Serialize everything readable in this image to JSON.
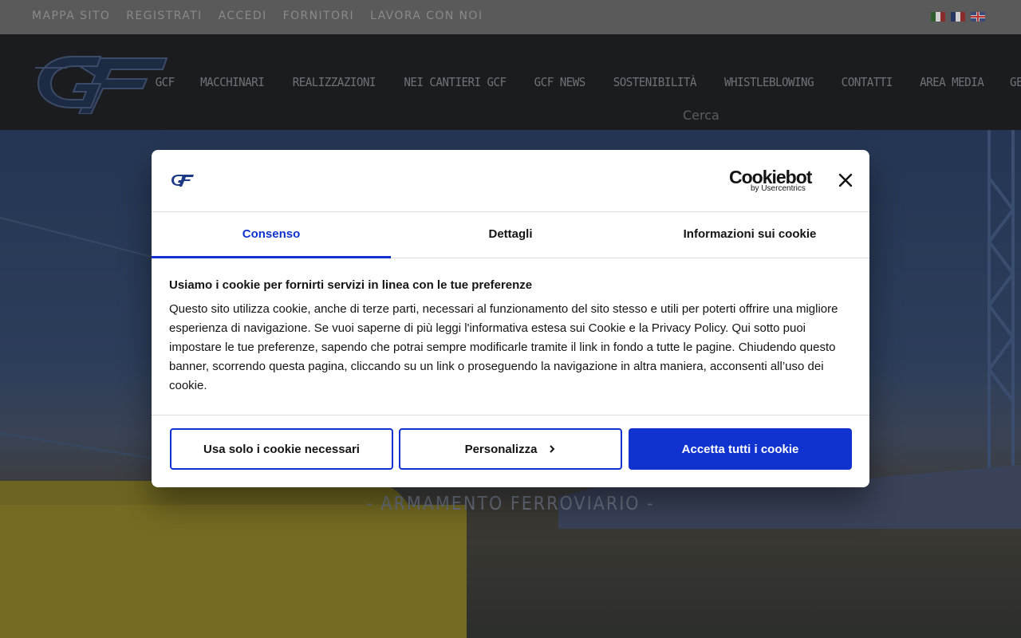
{
  "topbar": {
    "links": [
      "MAPPA SITO",
      "REGISTRATI",
      "ACCEDI",
      "FORNITORI",
      "LAVORA CON NOI"
    ],
    "languages": [
      "italian-flag-icon",
      "french-flag-icon",
      "uk-flag-icon"
    ]
  },
  "nav": {
    "items": [
      "GCF",
      "MACCHINARI",
      "REALIZZAZIONI",
      "NEI CANTIERI GCF",
      "GCF NEWS",
      "SOSTENIBILITÀ",
      "WHISTLEBLOWING",
      "CONTATTI",
      "AREA MEDIA",
      "GEFER"
    ],
    "search_placeholder": "Cerca"
  },
  "hero": {
    "subtitle": "- ARMAMENTO FERROVIARIO -"
  },
  "dialog": {
    "brand": "Cookiebot",
    "brand_by": "by Usercentrics",
    "tabs": [
      "Consenso",
      "Dettagli",
      "Informazioni sui cookie"
    ],
    "title": "Usiamo i cookie per fornirti servizi in linea con le tue preferenze",
    "text": "Questo sito utilizza cookie, anche di terze parti, necessari al funzionamento del sito stesso e utili per poterti offrire una migliore esperienza di navigazione. Se vuoi saperne di più leggi l'informativa estesa sui Cookie e la Privacy Policy. Qui sotto puoi impostare le tue preferenze, sapendo che potrai sempre modificarle tramite il link in fondo a tutte le pagine. Chiudendo questo banner, scorrendo questa pagina, cliccando su un link o proseguendo la navigazione in altra maniera, acconsenti all’uso dei cookie.",
    "buttons": {
      "necessary": "Usa solo i cookie necessari",
      "customize": "Personalizza",
      "accept_all": "Accetta tutti i cookie"
    }
  },
  "colors": {
    "accent": "#1032cf"
  }
}
